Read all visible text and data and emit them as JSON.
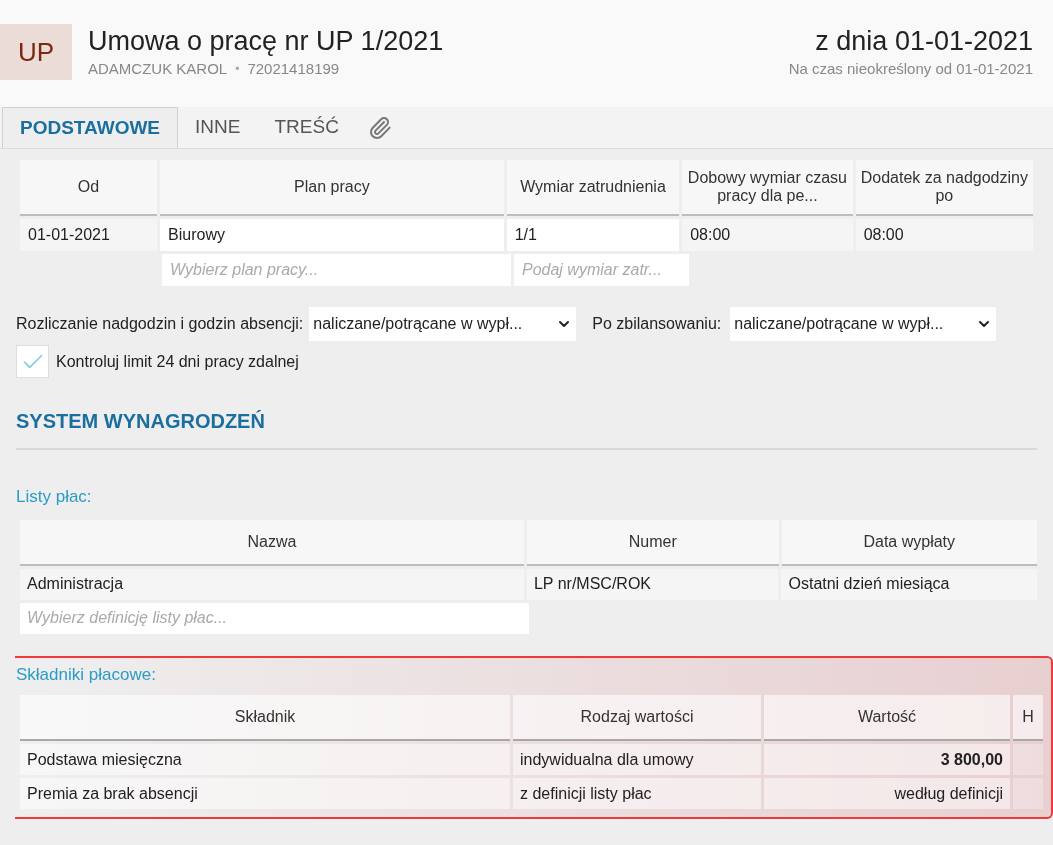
{
  "header": {
    "badge": "UP",
    "title": "Umowa o pracę nr UP 1/2021",
    "employee": "ADAMCZUK KAROL",
    "separator": "•",
    "pesel": "72021418199",
    "date": "z dnia 01-01-2021",
    "period": "Na czas nieokreślony od 01-01-2021"
  },
  "tabs": [
    {
      "kind": "text",
      "label": "PODSTAWOWE",
      "selected": true
    },
    {
      "kind": "text",
      "label": "INNE",
      "selected": false
    },
    {
      "kind": "text",
      "label": "TREŚĆ",
      "selected": false
    },
    {
      "kind": "attachment",
      "selected": false
    }
  ],
  "schedule": {
    "columns": [
      "Od",
      "Plan pracy",
      "Wymiar zatrudnienia",
      "Dobowy wymiar czasu pracy dla pe...",
      "Dodatek za nadgodziny po"
    ],
    "rows": [
      [
        "01-01-2021",
        "Biurowy",
        "1/1",
        "08:00",
        "08:00"
      ]
    ],
    "new_row": {
      "plan_placeholder": "Wybierz plan pracy...",
      "size_placeholder": "Podaj wymiar zatr..."
    }
  },
  "overtime": {
    "label": "Rozliczanie nadgodzin i godzin absencji:",
    "value": "naliczane/potrącane w wypł...",
    "after_label": "Po zbilansowaniu:",
    "after_value": "naliczane/potrącane w wypł..."
  },
  "remote_limit": {
    "label": "Kontroluj limit 24 dni pracy zdalnej",
    "checked": true
  },
  "section_title": "SYSTEM WYNAGRODZEŃ",
  "payrolls": {
    "label": "Listy płac:",
    "columns": [
      "Nazwa",
      "Numer",
      "Data wypłaty"
    ],
    "rows": [
      [
        "Administracja",
        "LP nr/MSC/ROK",
        "Ostatni dzień miesiąca"
      ]
    ],
    "placeholder": "Wybierz definicję listy płac..."
  },
  "components": {
    "label": "Składniki płacowe:",
    "highlighted": true,
    "columns": [
      "Składnik",
      "Rodzaj wartości",
      "Wartość",
      "H"
    ],
    "rows": [
      {
        "name": "Podstawa miesięczna",
        "type": "indywidualna dla umowy",
        "value": "3 800,00",
        "emphasized": true
      },
      {
        "name": "Premia za brak absencji",
        "type": "z definicji listy płac",
        "value": "według definicji",
        "emphasized": false
      }
    ]
  }
}
